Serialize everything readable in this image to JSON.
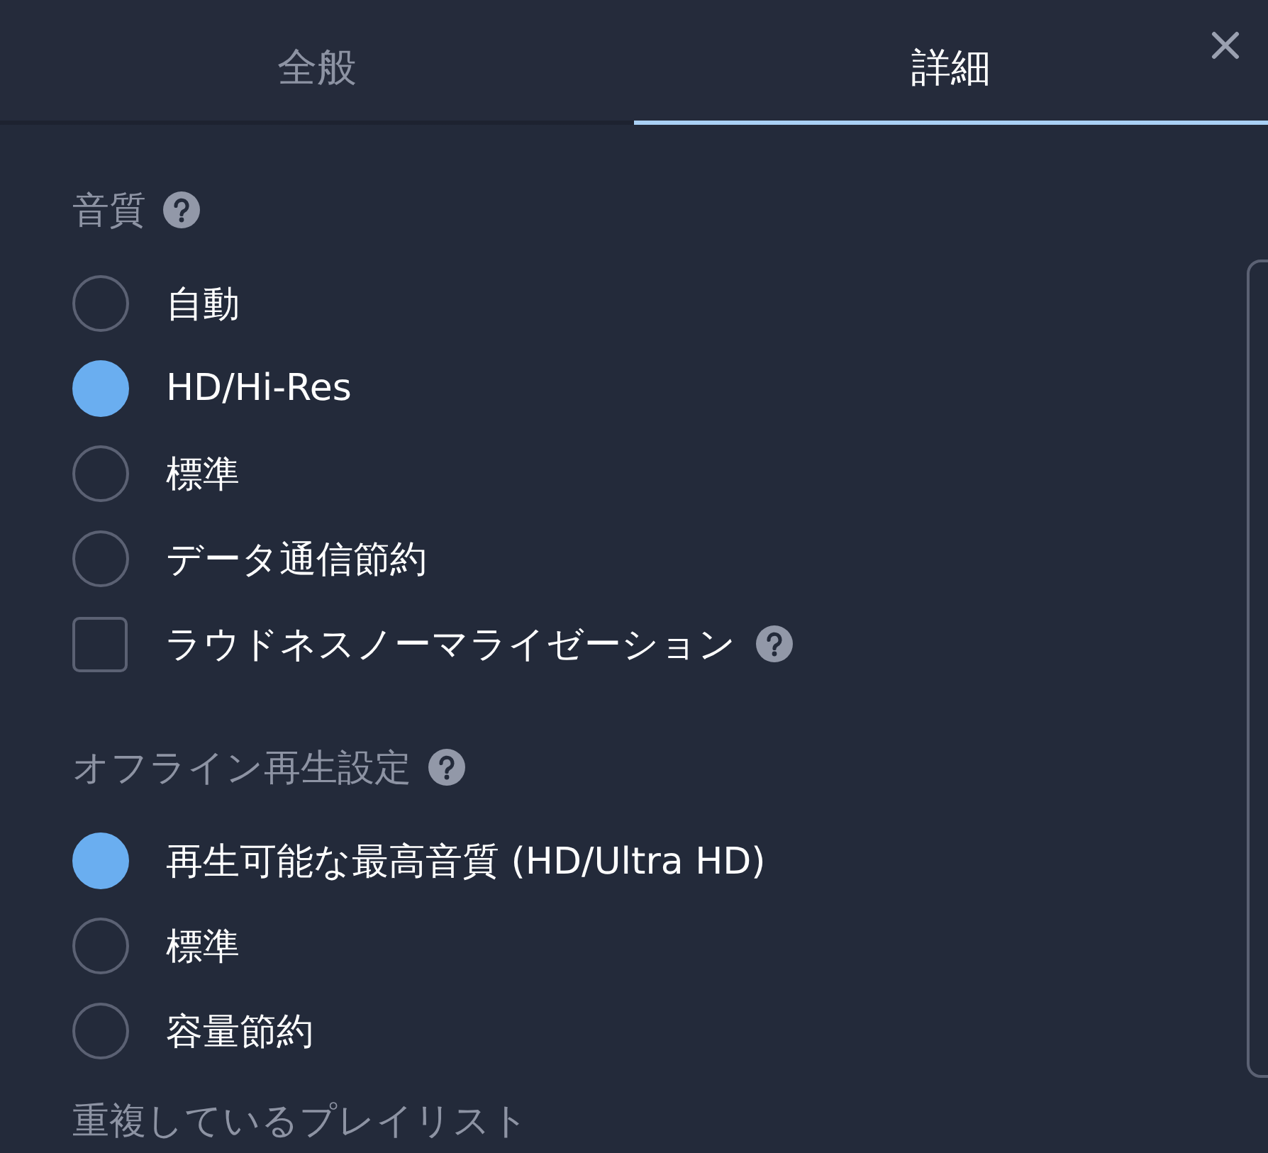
{
  "tabs": [
    {
      "label": "全般",
      "selected": false
    },
    {
      "label": "詳細",
      "selected": true
    }
  ],
  "sections": [
    {
      "title": "音質",
      "help": true,
      "options": [
        {
          "kind": "radio",
          "label": "自動",
          "selected": false
        },
        {
          "kind": "radio",
          "label": "HD/Hi-Res",
          "selected": true
        },
        {
          "kind": "radio",
          "label": "標準",
          "selected": false
        },
        {
          "kind": "radio",
          "label": "データ通信節約",
          "selected": false
        },
        {
          "kind": "checkbox",
          "label": "ラウドネスノーマライゼーション",
          "checked": false,
          "help": true
        }
      ]
    },
    {
      "title": "オフライン再生設定",
      "help": true,
      "options": [
        {
          "kind": "radio",
          "label": "再生可能な最高音質 (HD/Ultra HD)",
          "selected": true
        },
        {
          "kind": "radio",
          "label": "標準",
          "selected": false
        },
        {
          "kind": "radio",
          "label": "容量節約",
          "selected": false
        }
      ]
    },
    {
      "title": "重複しているプレイリスト",
      "help": false
    }
  ]
}
